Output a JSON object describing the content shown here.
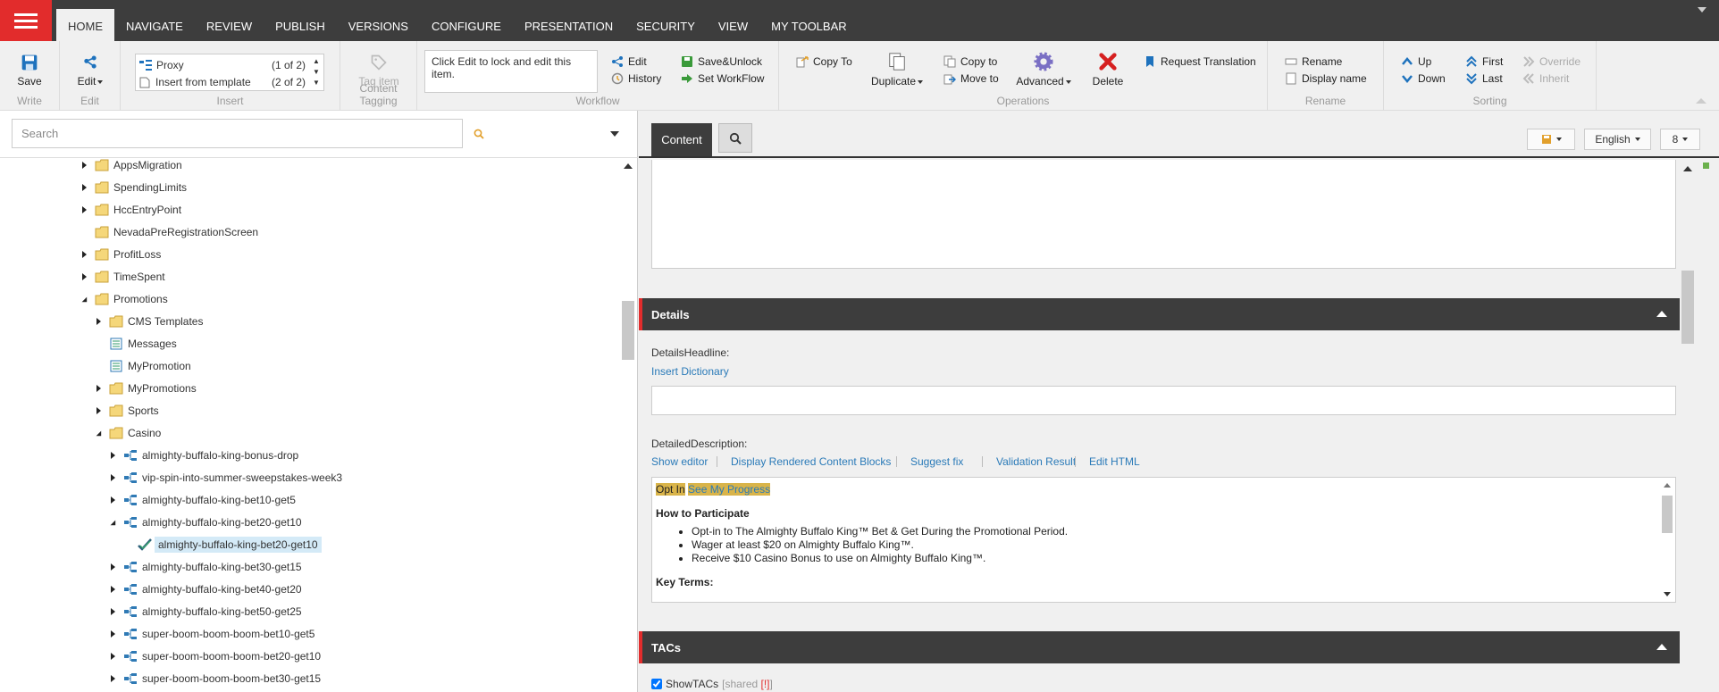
{
  "nav": {
    "tabs": [
      "HOME",
      "NAVIGATE",
      "REVIEW",
      "PUBLISH",
      "VERSIONS",
      "CONFIGURE",
      "PRESENTATION",
      "SECURITY",
      "VIEW",
      "MY TOOLBAR"
    ],
    "active_tab": "HOME"
  },
  "ribbon": {
    "write": {
      "save": "Save",
      "group": "Write"
    },
    "edit": {
      "edit": "Edit",
      "group": "Edit"
    },
    "insert": {
      "items": [
        {
          "label": "Proxy",
          "count": "(1 of 2)"
        },
        {
          "label": "Insert from template",
          "count": "(2 of 2)"
        }
      ],
      "group": "Insert"
    },
    "tagging": {
      "tag_item": "Tag item",
      "group": "Content Tagging"
    },
    "workflow": {
      "message": "Click Edit to lock and edit this item.",
      "edit": "Edit",
      "history": "History",
      "save_unlock": "Save&Unlock",
      "set_workflow": "Set WorkFlow",
      "group": "Workflow"
    },
    "operations": {
      "copy_to": "Copy To",
      "duplicate": "Duplicate",
      "copy_to2": "Copy to",
      "move_to": "Move to",
      "advanced": "Advanced",
      "delete": "Delete",
      "request_translation": "Request Translation",
      "group": "Operations"
    },
    "rename": {
      "rename": "Rename",
      "display_name": "Display name",
      "group": "Rename"
    },
    "sorting": {
      "up": "Up",
      "down": "Down",
      "first": "First",
      "last": "Last",
      "override": "Override",
      "inherit": "Inherit",
      "group": "Sorting"
    }
  },
  "left": {
    "search_placeholder": "Search",
    "tree": [
      {
        "label": "AppsMigration",
        "level": 0,
        "toggle": "closed",
        "icon": "folder"
      },
      {
        "label": "SpendingLimits",
        "level": 0,
        "toggle": "closed",
        "icon": "folder"
      },
      {
        "label": "HccEntryPoint",
        "level": 0,
        "toggle": "closed",
        "icon": "folder"
      },
      {
        "label": "NevadaPreRegistrationScreen",
        "level": 0,
        "toggle": "none",
        "icon": "folder"
      },
      {
        "label": "ProfitLoss",
        "level": 0,
        "toggle": "closed",
        "icon": "folder"
      },
      {
        "label": "TimeSpent",
        "level": 0,
        "toggle": "closed",
        "icon": "folder"
      },
      {
        "label": "Promotions",
        "level": 0,
        "toggle": "open",
        "icon": "folder"
      },
      {
        "label": "CMS Templates",
        "level": 1,
        "toggle": "closed",
        "icon": "folder"
      },
      {
        "label": "Messages",
        "level": 1,
        "toggle": "none",
        "icon": "list"
      },
      {
        "label": "MyPromotion",
        "level": 1,
        "toggle": "none",
        "icon": "list"
      },
      {
        "label": "MyPromotions",
        "level": 1,
        "toggle": "closed",
        "icon": "folder"
      },
      {
        "label": "Sports",
        "level": 1,
        "toggle": "closed",
        "icon": "folder"
      },
      {
        "label": "Casino",
        "level": 1,
        "toggle": "open",
        "icon": "folder"
      },
      {
        "label": "almighty-buffalo-king-bonus-drop",
        "level": 2,
        "toggle": "closed",
        "icon": "tree"
      },
      {
        "label": "vip-spin-into-summer-sweepstakes-week3",
        "level": 2,
        "toggle": "closed",
        "icon": "tree"
      },
      {
        "label": "almighty-buffalo-king-bet10-get5",
        "level": 2,
        "toggle": "closed",
        "icon": "tree"
      },
      {
        "label": "almighty-buffalo-king-bet20-get10",
        "level": 2,
        "toggle": "open",
        "icon": "tree"
      },
      {
        "label": "almighty-buffalo-king-bet20-get10",
        "level": 3,
        "toggle": "none",
        "icon": "check",
        "selected": true
      },
      {
        "label": "almighty-buffalo-king-bet30-get15",
        "level": 2,
        "toggle": "closed",
        "icon": "tree"
      },
      {
        "label": "almighty-buffalo-king-bet40-get20",
        "level": 2,
        "toggle": "closed",
        "icon": "tree"
      },
      {
        "label": "almighty-buffalo-king-bet50-get25",
        "level": 2,
        "toggle": "closed",
        "icon": "tree"
      },
      {
        "label": "super-boom-boom-boom-bet10-get5",
        "level": 2,
        "toggle": "closed",
        "icon": "tree"
      },
      {
        "label": "super-boom-boom-boom-bet20-get10",
        "level": 2,
        "toggle": "closed",
        "icon": "tree"
      },
      {
        "label": "super-boom-boom-boom-bet30-get15",
        "level": 2,
        "toggle": "closed",
        "icon": "tree"
      }
    ]
  },
  "right": {
    "tab_content": "Content",
    "language": "English",
    "version": "8",
    "details": {
      "title": "Details",
      "headline_label": "DetailsHeadline:",
      "insert_dictionary": "Insert Dictionary",
      "desc_label": "DetailedDescription:",
      "links": [
        "Show editor",
        "Display Rendered Content Blocks",
        "Suggest fix",
        "Validation Result",
        "Edit HTML"
      ],
      "content": {
        "opt_in": "Opt In",
        "see_progress": "See My Progress",
        "how_title": "How to Participate",
        "bullets": [
          "Opt-in to The Almighty Buffalo King™ Bet & Get During the Promotional Period.",
          "Wager at least $20 on Almighty Buffalo King™.",
          "Receive $10 Casino Bonus to use on Almighty Buffalo King™."
        ],
        "key_terms": "Key Terms:"
      }
    },
    "tacs": {
      "title": "TACs",
      "show_label": "ShowTACs",
      "shared_text": "[shared ",
      "shared_mark": "[!]",
      "shared_end": "]"
    }
  },
  "colors": {
    "accent": "#e22c2c",
    "dark": "#3d3d3d",
    "link": "#2a7ab8",
    "highlight": "#d9b44a"
  }
}
